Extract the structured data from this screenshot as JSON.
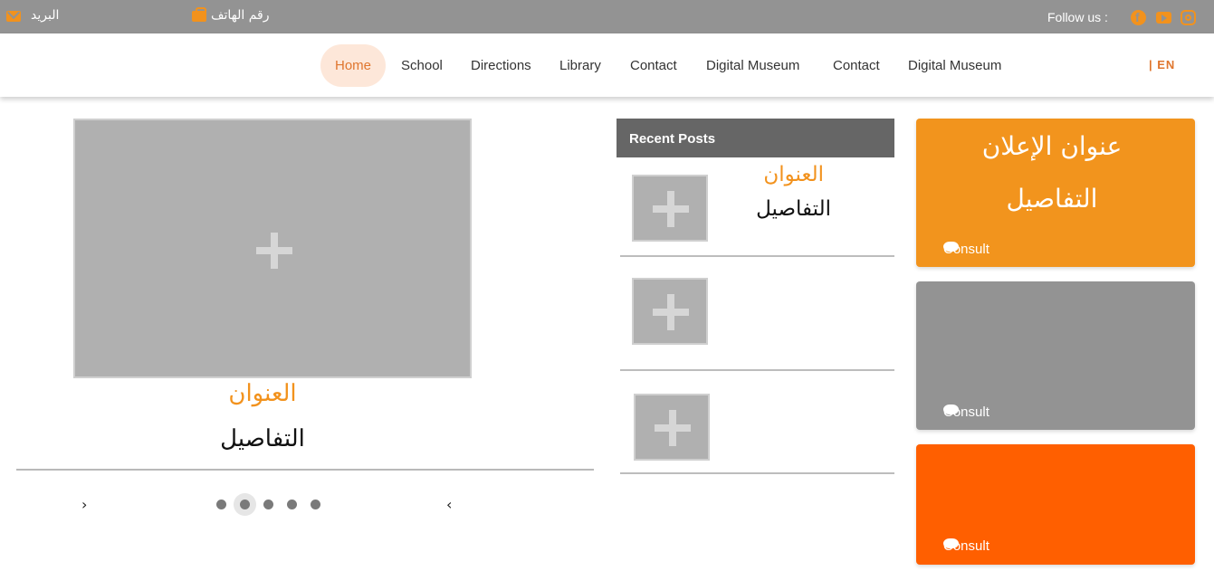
{
  "topbar": {
    "mail_label": "البريد",
    "phone_label": "رقم الهاتف",
    "follow_label": "Follow us :",
    "social_icons": [
      "facebook-icon",
      "youtube-icon",
      "instagram-icon"
    ]
  },
  "nav": {
    "items": [
      "Home",
      "School",
      "Directions",
      "Library",
      "Contact",
      "Digital Museum",
      "Contact",
      "Digital Museum"
    ],
    "active_index": 0,
    "lang_label": "| EN"
  },
  "slider": {
    "title": "العنوان",
    "details": "التفاصيل",
    "dot_count": 5,
    "active_dot": 1,
    "prev_arrow": "‹",
    "next_arrow": "›"
  },
  "recent_posts": {
    "header": "Recent Posts",
    "posts": [
      {
        "title": "العنوان",
        "details": "التفاصيل"
      },
      {
        "title": "",
        "details": ""
      },
      {
        "title": "",
        "details": ""
      }
    ]
  },
  "ads": [
    {
      "title": "عنوان الإعلان",
      "details": "التفاصيل",
      "consult_label": "Consult",
      "color": "#f2941d"
    },
    {
      "title": "",
      "details": "",
      "consult_label": "Consult",
      "color": "#939393"
    },
    {
      "title": "",
      "details": "",
      "consult_label": "Consult",
      "color": "#ff5f00"
    }
  ],
  "colors": {
    "accent": "#f2921d",
    "topbar": "#939393",
    "active_nav_bg": "#fde7d9",
    "active_nav_text": "#e0762e",
    "recent_posts_header": "#666666"
  }
}
